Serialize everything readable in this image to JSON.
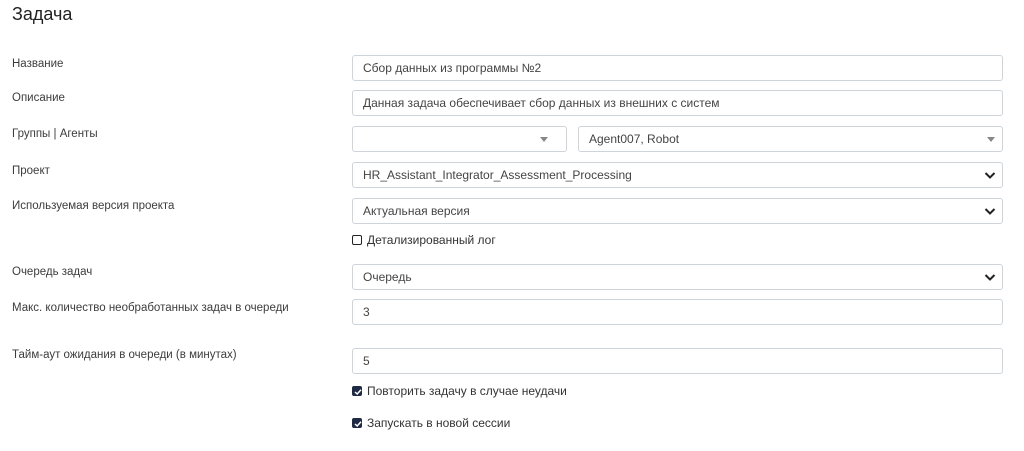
{
  "page": {
    "title": "Задача"
  },
  "form": {
    "name": {
      "label": "Название",
      "value": "Сбор данных из программы №2"
    },
    "description": {
      "label": "Описание",
      "value": "Данная задача обеспечивает сбор данных из внешних с систем"
    },
    "groups_agents": {
      "label": "Группы | Агенты",
      "groups_value": "",
      "agents_value": "Agent007, Robot"
    },
    "project": {
      "label": "Проект",
      "value": "HR_Assistant_Integrator_Assessment_Processing"
    },
    "project_version": {
      "label": "Используемая версия проекта",
      "value": "Актуальная версия"
    },
    "detailed_log": {
      "label": "Детализированный лог",
      "checked": false
    },
    "task_queue": {
      "label": "Очередь задач",
      "value": "Очередь"
    },
    "max_unprocessed": {
      "label": "Макс. количество необработанных задач в очереди",
      "value": "3"
    },
    "queue_timeout": {
      "label": "Тайм-аут ожидания в очереди (в минутах)",
      "value": "5"
    },
    "retry_on_failure": {
      "label": "Повторить задачу в случае неудачи",
      "checked": true
    },
    "run_new_session": {
      "label": "Запускать в новой сессии",
      "checked": true
    }
  }
}
